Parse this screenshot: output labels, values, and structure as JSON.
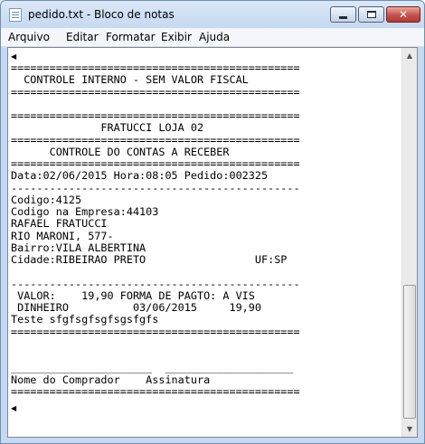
{
  "window": {
    "title": "pedido.txt - Bloco de notas"
  },
  "menu": {
    "items": [
      "Arquivo",
      "Editar",
      "Formatar",
      "Exibir",
      "Ajuda"
    ]
  },
  "document": {
    "lines": [
      "=============================================",
      "  CONTROLE INTERNO - SEM VALOR FISCAL",
      "=============================================",
      "",
      "=============================================",
      "              FRATUCCI LOJA 02",
      "=============================================",
      "      CONTROLE DO CONTAS A RECEBER",
      "=============================================",
      "Data:02/06/2015 Hora:08:05 Pedido:002325",
      "---------------------------------------------",
      "Codigo:4125",
      "Codigo na Empresa:44103",
      "RAFAEL FRATUCCI",
      "RIO MARONI, 577-",
      "Bairro:VILA ALBERTINA",
      "Cidade:RIBEIRAO PRETO                 UF:SP",
      "",
      "---------------------------------------------",
      " VALOR:    19,90 FORMA DE PAGTO: A VIS",
      " DINHEIRO          03/06/2015     19,90",
      "Teste sfgfsgfsgfsgsfgfs",
      "=============================================",
      "",
      "",
      "______________________  ____________________",
      "Nome do Comprador    Assinatura",
      "=============================================",
      "",
      ""
    ]
  }
}
